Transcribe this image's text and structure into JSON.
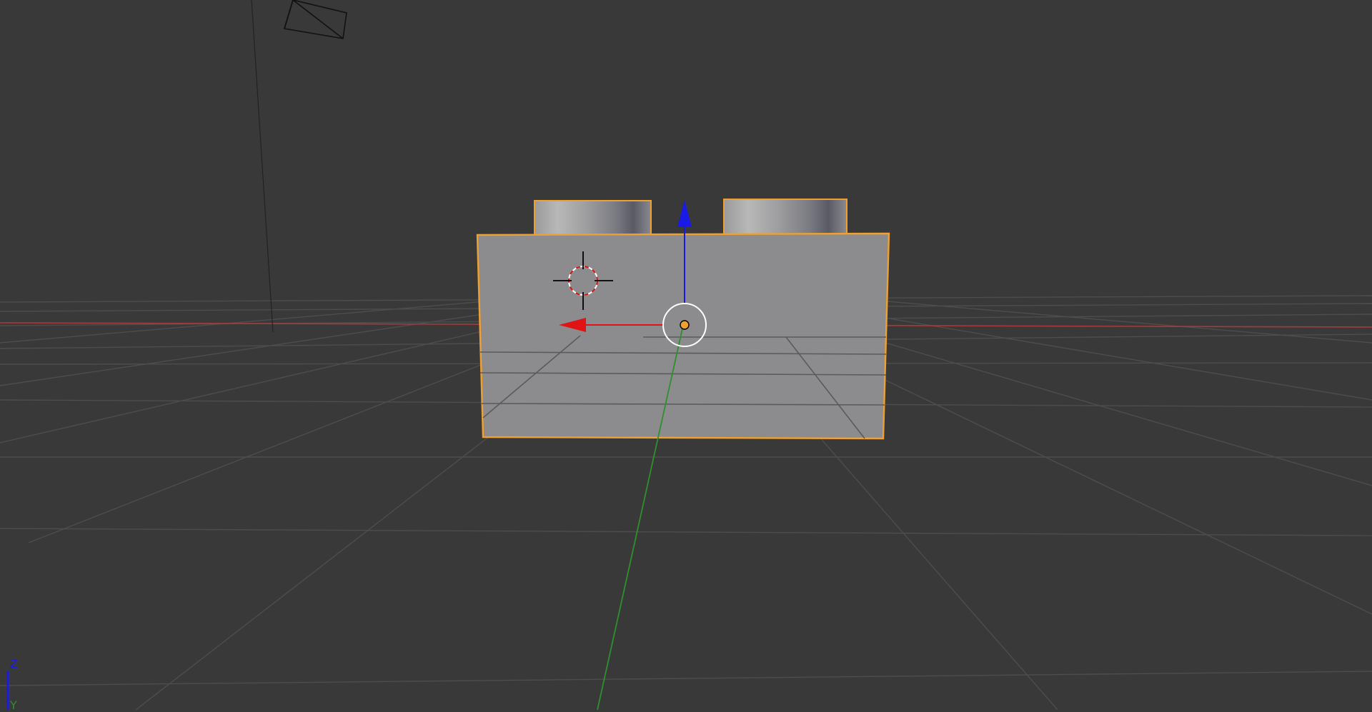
{
  "viewport": {
    "axis_widget": {
      "z_label": "Z",
      "y_label": "Y"
    }
  },
  "colors": {
    "background": "#393939",
    "grid": "#4a4a4a",
    "grid_x_axis": "#a33333",
    "grid_y_axis": "#2f8f2f",
    "gizmo_x": "#e01414",
    "gizmo_y": "#2f8f2f",
    "gizmo_z": "#1414e0",
    "selection_outline": "#f0a030",
    "mesh_face": "#8c8c8e",
    "camera_wire": "#000000"
  },
  "icons": {
    "cursor": "3d-cursor-icon",
    "pivot": "object-origin-icon",
    "camera": "camera-object-icon"
  }
}
